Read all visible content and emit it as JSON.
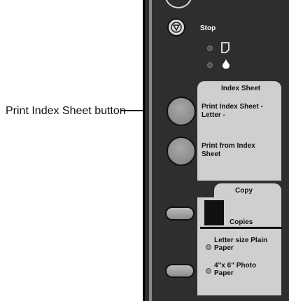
{
  "callout": {
    "label": "Print Index Sheet button"
  },
  "panel": {
    "stop": {
      "label": "Stop"
    },
    "indicators": [
      {
        "icon": "paper-icon"
      },
      {
        "icon": "ink-drop-icon"
      }
    ],
    "index_sheet": {
      "title": "Index Sheet",
      "print_index_label": "Print Index Sheet - Letter -",
      "print_from_label": "Print from Index Sheet"
    },
    "copy": {
      "title": "Copy",
      "copies_label": "Copies",
      "option_letter": "Letter size Plain Paper",
      "option_photo": "4\"x 6\" Photo Paper"
    }
  }
}
